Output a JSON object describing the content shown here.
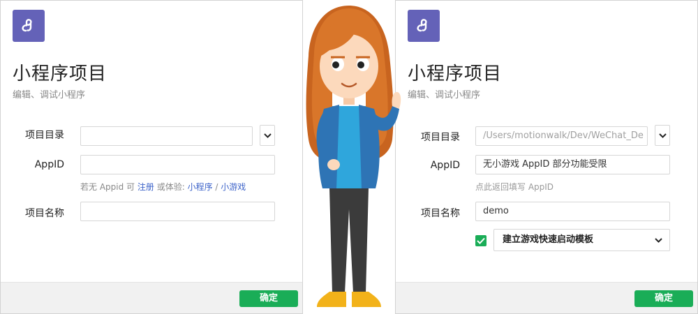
{
  "left_panel": {
    "title": "小程序项目",
    "subtitle": "编辑、调试小程序",
    "project_dir_label": "项目目录",
    "project_dir_value": "",
    "appid_label": "AppID",
    "appid_value": "",
    "hint_prefix": "若无 Appid 可",
    "hint_register": "注册",
    "hint_middle": "或体验:",
    "hint_miniprogram": "小程序",
    "hint_separator": "/",
    "hint_minigame": "小游戏",
    "project_name_label": "项目名称",
    "project_name_value": "",
    "confirm_label": "确定"
  },
  "right_panel": {
    "title": "小程序项目",
    "subtitle": "编辑、调试小程序",
    "project_dir_label": "项目目录",
    "project_dir_value": "/Users/motionwalk/Dev/WeChat_De",
    "appid_label": "AppID",
    "appid_value": "无小游戏 AppID 部分功能受限",
    "appid_hint": "点此返回填写 AppID",
    "project_name_label": "项目名称",
    "project_name_value": "demo",
    "template_checked": true,
    "template_select_value": "建立游戏快速启动模板",
    "confirm_label": "确定"
  },
  "colors": {
    "logo_bg": "#6462b8",
    "accent_green": "#1aad57",
    "link_blue": "#3d63c9"
  }
}
